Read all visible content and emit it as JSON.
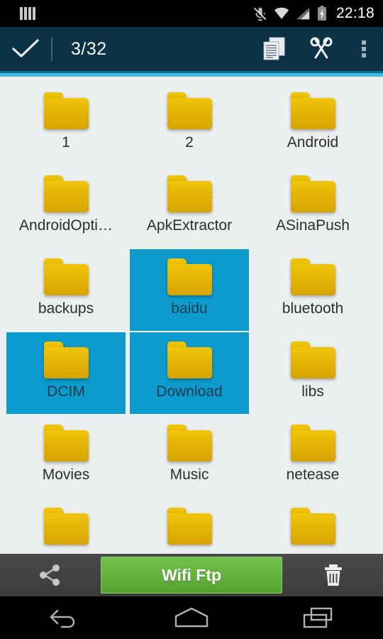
{
  "statusbar": {
    "notification_icon": "signal-bars-icon",
    "icons": [
      "vibrate-off-icon",
      "wifi-icon",
      "cellular-signal-icon",
      "battery-charging-icon"
    ],
    "time": "22:18"
  },
  "actionbar": {
    "confirm_icon": "checkmark-icon",
    "selection_count": "3/32",
    "copy_icon": "copy-icon",
    "cut_icon": "scissors-icon",
    "overflow_icon": "more-vertical-icon",
    "background_color": "#0d3245",
    "accent_color": "#45b4e0"
  },
  "grid": {
    "selection_color": "#0d9bcd",
    "background_color": "#eceff0",
    "items": [
      {
        "name": "1",
        "selected": false,
        "icon": "folder-icon"
      },
      {
        "name": "2",
        "selected": false,
        "icon": "folder-icon"
      },
      {
        "name": "Android",
        "selected": false,
        "icon": "folder-icon"
      },
      {
        "name": "AndroidOpti…",
        "selected": false,
        "icon": "folder-icon"
      },
      {
        "name": "ApkExtractor",
        "selected": false,
        "icon": "folder-icon"
      },
      {
        "name": "ASinaPush",
        "selected": false,
        "icon": "folder-icon"
      },
      {
        "name": "backups",
        "selected": false,
        "icon": "folder-icon"
      },
      {
        "name": "baidu",
        "selected": true,
        "icon": "folder-icon"
      },
      {
        "name": "bluetooth",
        "selected": false,
        "icon": "folder-icon"
      },
      {
        "name": "DCIM",
        "selected": true,
        "icon": "folder-icon"
      },
      {
        "name": "Download",
        "selected": true,
        "icon": "folder-icon"
      },
      {
        "name": "libs",
        "selected": false,
        "icon": "folder-icon"
      },
      {
        "name": "Movies",
        "selected": false,
        "icon": "folder-icon"
      },
      {
        "name": "Music",
        "selected": false,
        "icon": "folder-icon"
      },
      {
        "name": "netease",
        "selected": false,
        "icon": "folder-icon"
      },
      {
        "name": "",
        "selected": false,
        "icon": "folder-icon"
      },
      {
        "name": "",
        "selected": false,
        "icon": "folder-icon"
      },
      {
        "name": "",
        "selected": false,
        "icon": "folder-icon"
      }
    ]
  },
  "bottombar": {
    "share_icon": "share-icon",
    "wifi_ftp_label": "Wifi Ftp",
    "delete_icon": "trash-icon",
    "button_color": "#64b03d"
  },
  "navbar": {
    "back_icon": "back-arrow-icon",
    "home_icon": "home-icon",
    "recents_icon": "recents-icon"
  }
}
